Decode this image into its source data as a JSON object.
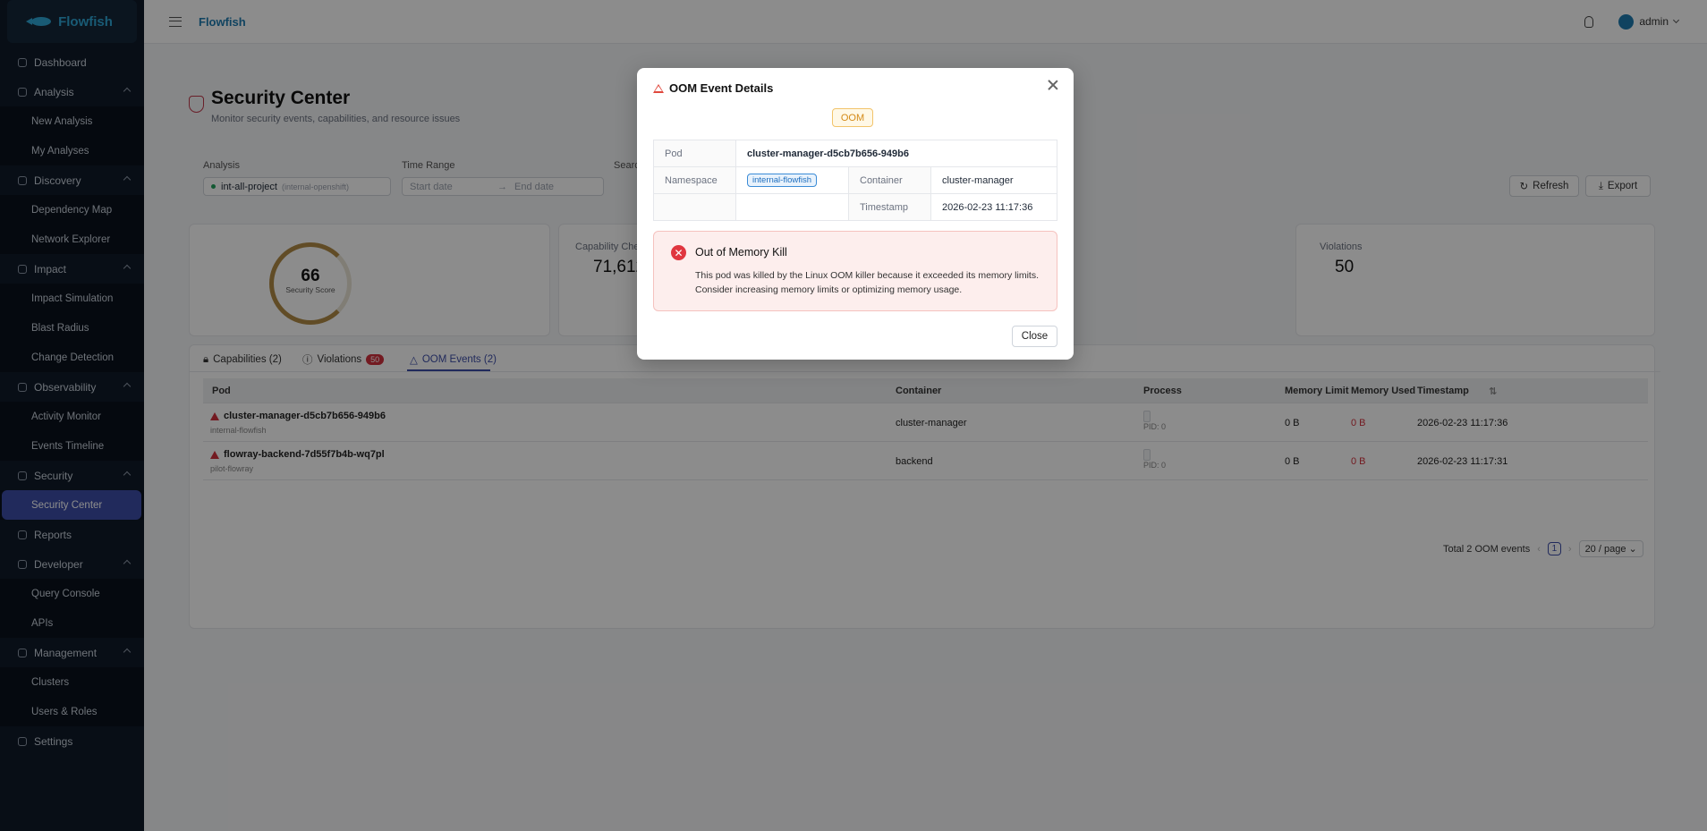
{
  "app": {
    "brand": "Flowfish",
    "header_title": "Flowfish",
    "user": "admin"
  },
  "sidebar": {
    "dashboard": "Dashboard",
    "analysis": {
      "label": "Analysis",
      "items": [
        "New Analysis",
        "My Analyses"
      ]
    },
    "discovery": {
      "label": "Discovery",
      "items": [
        "Dependency Map",
        "Network Explorer"
      ]
    },
    "impact": {
      "label": "Impact",
      "items": [
        "Impact Simulation",
        "Blast Radius",
        "Change Detection"
      ]
    },
    "observability": {
      "label": "Observability",
      "items": [
        "Activity Monitor",
        "Events Timeline"
      ]
    },
    "security": {
      "label": "Security",
      "items": [
        "Security Center"
      ]
    },
    "reports": "Reports",
    "developer": {
      "label": "Developer",
      "items": [
        "Query Console",
        "APIs"
      ]
    },
    "management": {
      "label": "Management",
      "items": [
        "Clusters",
        "Users & Roles"
      ]
    },
    "settings": "Settings"
  },
  "page": {
    "title": "Security Center",
    "subtitle": "Monitor security events, capabilities, and resource issues",
    "filters": {
      "analysis_label": "Analysis",
      "analysis_value": "int-all-project",
      "analysis_sub": "(internal-openshift)",
      "time_label": "Time Range",
      "start_placeholder": "Start date",
      "end_placeholder": "End date",
      "search_label": "Searc"
    },
    "refresh": "Refresh",
    "export": "Export",
    "score": {
      "value": "66",
      "label": "Security Score"
    },
    "capability": {
      "label": "Capability Che",
      "value": "71,612"
    },
    "violations": {
      "label": "Violations",
      "value": "50"
    }
  },
  "tabs": {
    "capabilities": "Capabilities (2)",
    "violations": "Violations",
    "violations_badge": "50",
    "oom": "OOM Events (2)"
  },
  "table": {
    "headers": [
      "Pod",
      "Container",
      "Process",
      "Memory Limit",
      "Memory Used",
      "Timestamp"
    ],
    "rows": [
      {
        "pod": "cluster-manager-d5cb7b656-949b6",
        "ns": "internal-flowfish",
        "container": "cluster-manager",
        "pid": "PID: 0",
        "limit": "0 B",
        "used": "0 B",
        "ts": "2026-02-23 11:17:36"
      },
      {
        "pod": "flowray-backend-7d55f7b4b-wq7pl",
        "ns": "pilot-flowray",
        "container": "backend",
        "pid": "PID: 0",
        "limit": "0 B",
        "used": "0 B",
        "ts": "2026-02-23 11:17:31"
      }
    ],
    "total": "Total 2 OOM events",
    "page": "1",
    "page_size": "20 / page"
  },
  "modal": {
    "title": "OOM Event Details",
    "tag": "OOM",
    "pod_label": "Pod",
    "pod": "cluster-manager-d5cb7b656-949b6",
    "ns_label": "Namespace",
    "ns": "internal-flowfish",
    "container_label": "Container",
    "container": "cluster-manager",
    "ts_label": "Timestamp",
    "ts": "2026-02-23 11:17:36",
    "alert_title": "Out of Memory Kill",
    "alert_text": "This pod was killed by the Linux OOM killer because it exceeded its memory limits. Consider increasing memory limits or optimizing memory usage.",
    "close": "Close"
  },
  "colors": {
    "accent": "#3d4ea8",
    "danger": "#d1303c",
    "warning": "#d48a17",
    "sidebar_bg": "#0f1a28"
  }
}
